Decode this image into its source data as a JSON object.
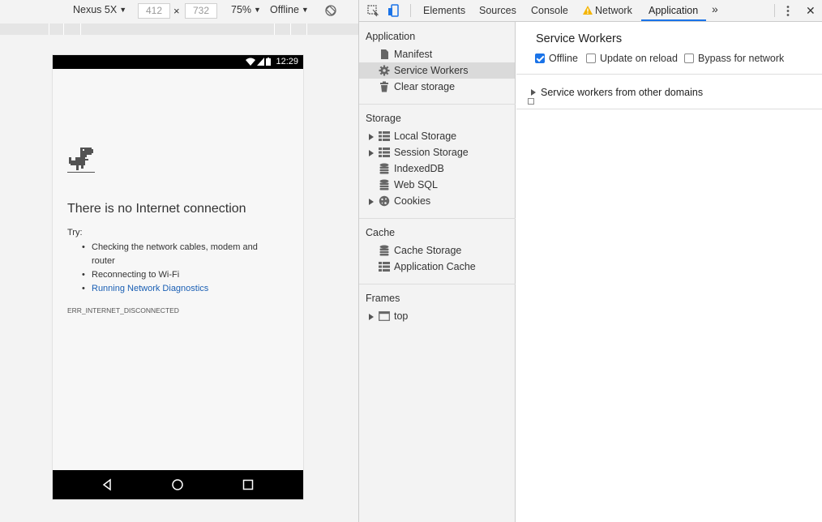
{
  "device_toolbar": {
    "device": "Nexus 5X",
    "width": "412",
    "height": "732",
    "times": "×",
    "zoom": "75%",
    "network": "Offline"
  },
  "phone": {
    "time": "12:29",
    "error_title": "There is no Internet connection",
    "try_label": "Try:",
    "suggestions": [
      "Checking the network cables, modem and router",
      "Reconnecting to Wi-Fi",
      "Running Network Diagnostics"
    ],
    "error_code": "ERR_INTERNET_DISCONNECTED"
  },
  "devtools": {
    "tabs": [
      "Elements",
      "Sources",
      "Console",
      "Network",
      "Application"
    ],
    "active_tab": "Application",
    "more_tabs": "»",
    "close": "✕",
    "accent_color": "#1a73e8",
    "warning_color": "#f4b400"
  },
  "sidebar": {
    "application": {
      "title": "Application",
      "items": [
        "Manifest",
        "Service Workers",
        "Clear storage"
      ]
    },
    "storage": {
      "title": "Storage",
      "items": [
        "Local Storage",
        "Session Storage",
        "IndexedDB",
        "Web SQL",
        "Cookies"
      ]
    },
    "cache": {
      "title": "Cache",
      "items": [
        "Cache Storage",
        "Application Cache"
      ]
    },
    "frames": {
      "title": "Frames",
      "items": [
        "top"
      ]
    },
    "selected": "Service Workers"
  },
  "main": {
    "title": "Service Workers",
    "options": [
      {
        "label": "Offline",
        "checked": true
      },
      {
        "label": "Update on reload",
        "checked": false
      },
      {
        "label": "Bypass for network",
        "checked": false
      }
    ],
    "other_domains": "Service workers from other domains"
  }
}
